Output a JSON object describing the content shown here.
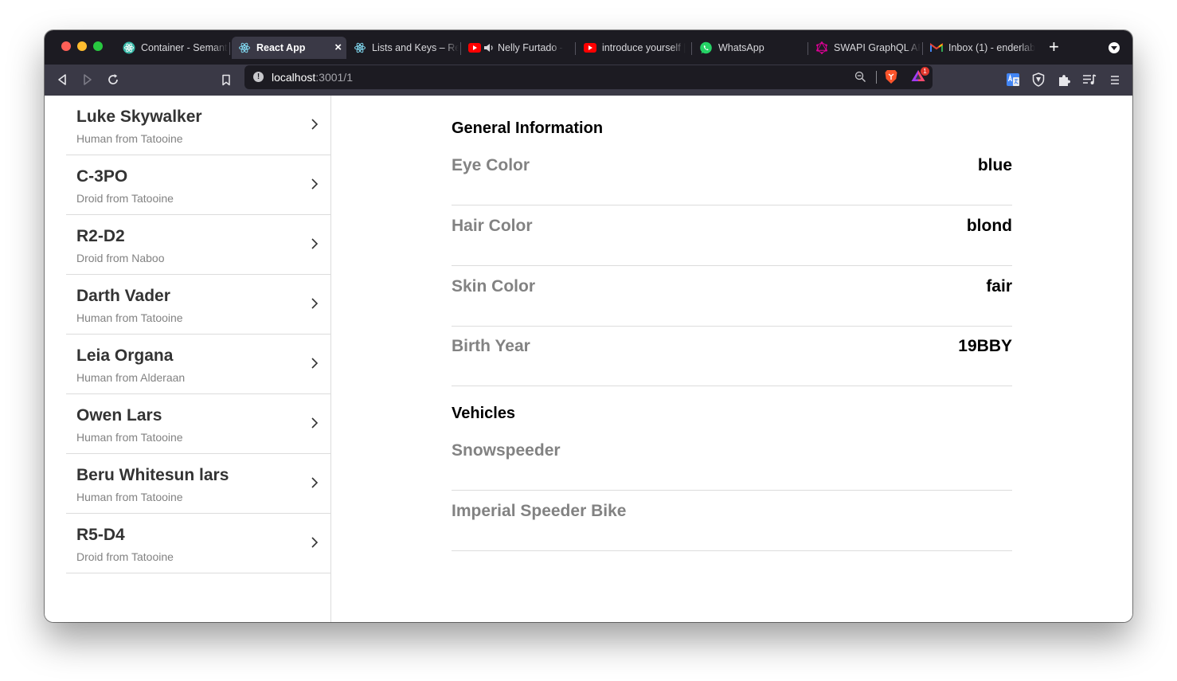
{
  "browser": {
    "tabs": [
      {
        "title": "Container - Semantic UI",
        "icon": "react-icon",
        "active": false
      },
      {
        "title": "React App",
        "icon": "react-icon",
        "active": true
      },
      {
        "title": "Lists and Keys – React",
        "icon": "react-icon",
        "active": false
      },
      {
        "title": "Nelly Furtado -",
        "icon": "youtube-icon",
        "active": false
      },
      {
        "title": "introduce yourself |",
        "icon": "youtube-icon",
        "active": false
      },
      {
        "title": "WhatsApp",
        "icon": "whatsapp-icon",
        "active": false
      },
      {
        "title": "SWAPI GraphQL API",
        "icon": "graphql-icon",
        "active": false
      },
      {
        "title": "Inbox (1) - enderlab",
        "icon": "gmail-icon",
        "active": false
      }
    ],
    "close_tab_glyph": "×",
    "new_tab_glyph": "+",
    "address": {
      "host": "localhost",
      "rest": ":3001/1"
    },
    "rewards_badge": "1"
  },
  "people": [
    {
      "name": "Luke Skywalker",
      "subtitle": "Human from Tatooine"
    },
    {
      "name": "C-3PO",
      "subtitle": "Droid from Tatooine"
    },
    {
      "name": "R2-D2",
      "subtitle": "Droid from Naboo"
    },
    {
      "name": "Darth Vader",
      "subtitle": "Human from Tatooine"
    },
    {
      "name": "Leia Organa",
      "subtitle": "Human from Alderaan"
    },
    {
      "name": "Owen Lars",
      "subtitle": "Human from Tatooine"
    },
    {
      "name": "Beru Whitesun lars",
      "subtitle": "Human from Tatooine"
    },
    {
      "name": "R5-D4",
      "subtitle": "Droid from Tatooine"
    }
  ],
  "detail": {
    "general_title": "General Information",
    "info": [
      {
        "label": "Eye Color",
        "value": "blue"
      },
      {
        "label": "Hair Color",
        "value": "blond"
      },
      {
        "label": "Skin Color",
        "value": "fair"
      },
      {
        "label": "Birth Year",
        "value": "19BBY"
      }
    ],
    "vehicles_title": "Vehicles",
    "vehicles": [
      "Snowspeeder",
      "Imperial Speeder Bike"
    ]
  },
  "colors": {
    "titlebar": "#1c1b22",
    "toolbar": "#3a3946",
    "heading": "#333333",
    "muted": "#828282",
    "divider": "#dcdcdc"
  }
}
